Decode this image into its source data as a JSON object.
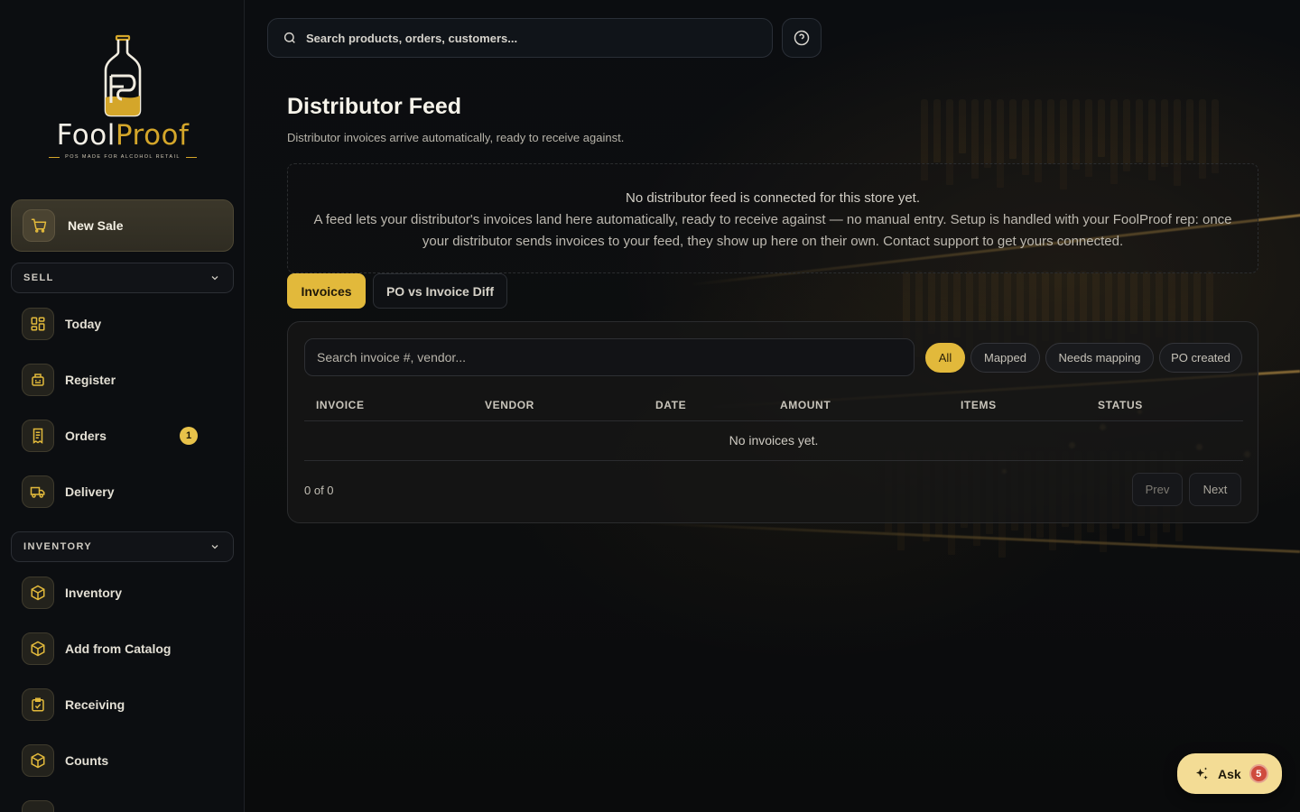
{
  "brand": {
    "name_part1": "Fool",
    "name_part2": "Proof",
    "tagline": "POS MADE FOR ALCOHOL RETAIL",
    "accent_color": "#d4a62a"
  },
  "sidebar": {
    "new_sale_label": "New Sale",
    "sections": [
      {
        "label": "SELL"
      },
      {
        "label": "INVENTORY"
      }
    ],
    "sell_items": [
      {
        "label": "Today",
        "icon": "dashboard-icon"
      },
      {
        "label": "Register",
        "icon": "register-icon"
      },
      {
        "label": "Orders",
        "icon": "receipt-icon",
        "badge": "1"
      },
      {
        "label": "Delivery",
        "icon": "truck-icon"
      }
    ],
    "inventory_items": [
      {
        "label": "Inventory",
        "icon": "box-icon"
      },
      {
        "label": "Add from Catalog",
        "icon": "box-icon"
      },
      {
        "label": "Receiving",
        "icon": "clipboard-check-icon"
      },
      {
        "label": "Counts",
        "icon": "box-icon"
      }
    ]
  },
  "topbar": {
    "search_placeholder": "Search products, orders, customers..."
  },
  "page": {
    "title": "Distributor Feed",
    "subtitle": "Distributor invoices arrive automatically, ready to receive against."
  },
  "notice": {
    "line1": "No distributor feed is connected for this store yet.",
    "line2": "A feed lets your distributor's invoices land here automatically, ready to receive against — no manual entry. Setup is handled with your FoolProof rep: once your distributor sends invoices to your feed, they show up here on their own. Contact support to get yours connected."
  },
  "tabs": [
    {
      "label": "Invoices",
      "active": true
    },
    {
      "label": "PO vs Invoice Diff",
      "active": false
    }
  ],
  "invoices": {
    "search_placeholder": "Search invoice #, vendor...",
    "filters": [
      {
        "label": "All",
        "active": true
      },
      {
        "label": "Mapped",
        "active": false
      },
      {
        "label": "Needs mapping",
        "active": false
      },
      {
        "label": "PO created",
        "active": false
      }
    ],
    "columns": [
      "INVOICE",
      "VENDOR",
      "DATE",
      "AMOUNT",
      "ITEMS",
      "STATUS"
    ],
    "empty_text": "No invoices yet.",
    "count_text": "0 of 0",
    "prev_label": "Prev",
    "next_label": "Next"
  },
  "ask": {
    "label": "Ask",
    "badge": "5"
  }
}
